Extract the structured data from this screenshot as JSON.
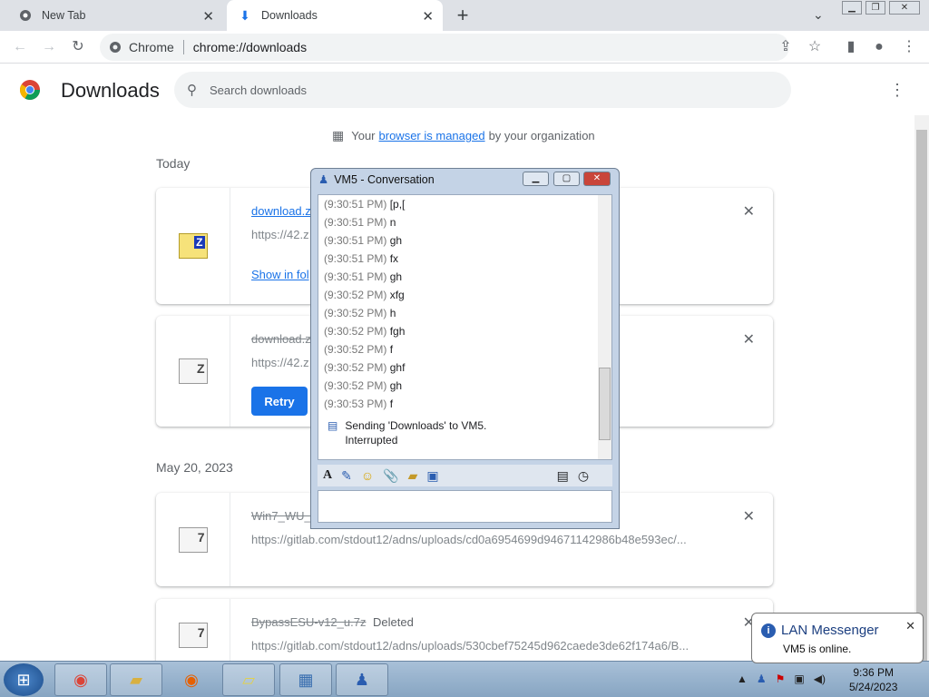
{
  "tabs": [
    {
      "label": "New Tab",
      "icon": "chrome-icon"
    },
    {
      "label": "Downloads",
      "icon": "download-icon"
    }
  ],
  "omnibox": {
    "chip": "Chrome",
    "url": "chrome://downloads"
  },
  "downloads": {
    "title": "Downloads",
    "search_placeholder": "Search downloads",
    "managed": {
      "pre": "Your",
      "link": "browser is managed",
      "post": "by your organization"
    },
    "groups": [
      {
        "date": "Today"
      },
      {
        "date": "May 20, 2023"
      }
    ],
    "items": [
      {
        "name": "download.z",
        "url": "https://42.z",
        "action": "Show in fol",
        "icon": "zip-file-icon"
      },
      {
        "name": "download.z",
        "url": "https://42.z",
        "action": "Retry",
        "icon": "file-icon",
        "icon_glyph": "Z"
      },
      {
        "name": "Win7_WU_E",
        "url": "https://gitlab.com/stdout12/adns/uploads/cd0a6954699d94671142986b48e593ec/...",
        "icon": "file-icon",
        "icon_glyph": "7"
      },
      {
        "name": "BypassESU-v12_u.7z",
        "status": "Deleted",
        "url": "https://gitlab.com/stdout12/adns/uploads/530cbef75245d962caede3de62f174a6/B...",
        "icon": "file-icon",
        "icon_glyph": "7"
      }
    ]
  },
  "conversation": {
    "title": "VM5 - Conversation",
    "lines": [
      {
        "time": "(9:30:51 PM)",
        "text": "[p,["
      },
      {
        "time": "(9:30:51 PM)",
        "text": "n"
      },
      {
        "time": "(9:30:51 PM)",
        "text": "gh"
      },
      {
        "time": "(9:30:51 PM)",
        "text": "fx"
      },
      {
        "time": "(9:30:51 PM)",
        "text": "gh"
      },
      {
        "time": "(9:30:52 PM)",
        "text": "xfg"
      },
      {
        "time": "(9:30:52 PM)",
        "text": "h"
      },
      {
        "time": "(9:30:52 PM)",
        "text": "fgh"
      },
      {
        "time": "(9:30:52 PM)",
        "text": "f"
      },
      {
        "time": "(9:30:52 PM)",
        "text": "ghf"
      },
      {
        "time": "(9:30:52 PM)",
        "text": "gh"
      },
      {
        "time": "(9:30:53 PM)",
        "text": "f"
      }
    ],
    "sending": "Sending 'Downloads' to VM5.",
    "sending_status": "Interrupted"
  },
  "taskbar": {
    "time": "9:36 PM",
    "date": "5/24/2023"
  },
  "notification": {
    "title": "LAN Messenger",
    "body": "VM5 is online."
  }
}
